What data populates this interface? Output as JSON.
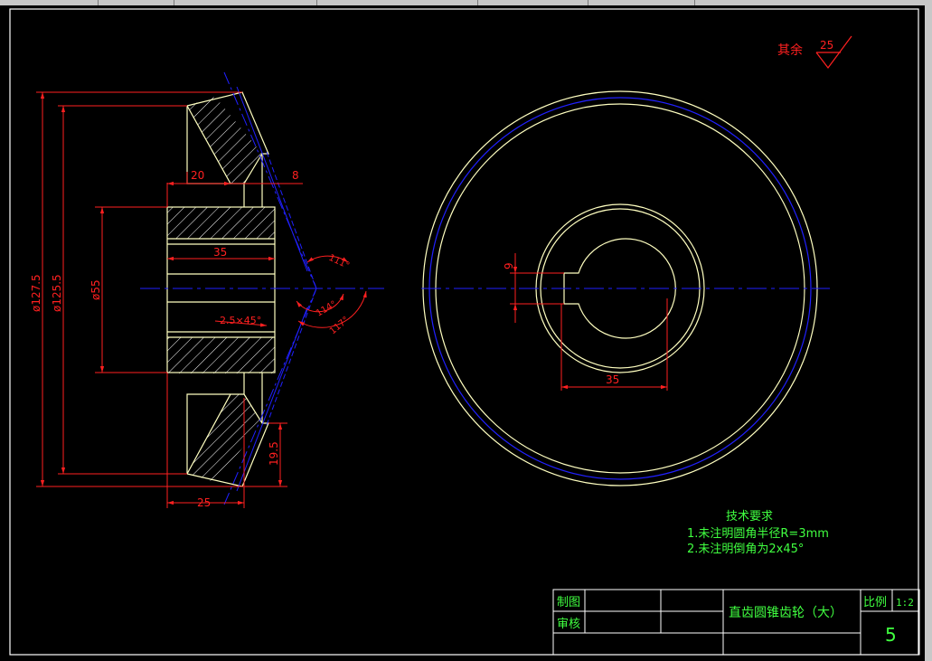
{
  "finish": {
    "prefix": "其余",
    "value": "25"
  },
  "dims": {
    "d127": "ø127.5",
    "d125": "ø125.5",
    "d55": "ø55",
    "w20": "20",
    "w8": "8",
    "w35_left": "35",
    "chamfer": "2.5×45°",
    "w25": "25",
    "h19": "19.5",
    "a111": "111°",
    "a114": "114°",
    "a117": "117°",
    "key9": "9",
    "w35_right": "35"
  },
  "notes": {
    "title": "技术要求",
    "line1": "1.未注明圆角半径R=3mm",
    "line2": "2.未注明倒角为2x45°"
  },
  "title_block": {
    "drawn": "制图",
    "checked": "审核",
    "part_name": "直齿圆锥齿轮（大）",
    "scale_label": "比例",
    "scale_value": "1:2",
    "sheet": "5"
  },
  "colors": {
    "outline": "#ffffc0",
    "dimension": "#ff2020",
    "center": "#2020ff",
    "text_green": "#40ff40",
    "frame": "#ffffff"
  }
}
